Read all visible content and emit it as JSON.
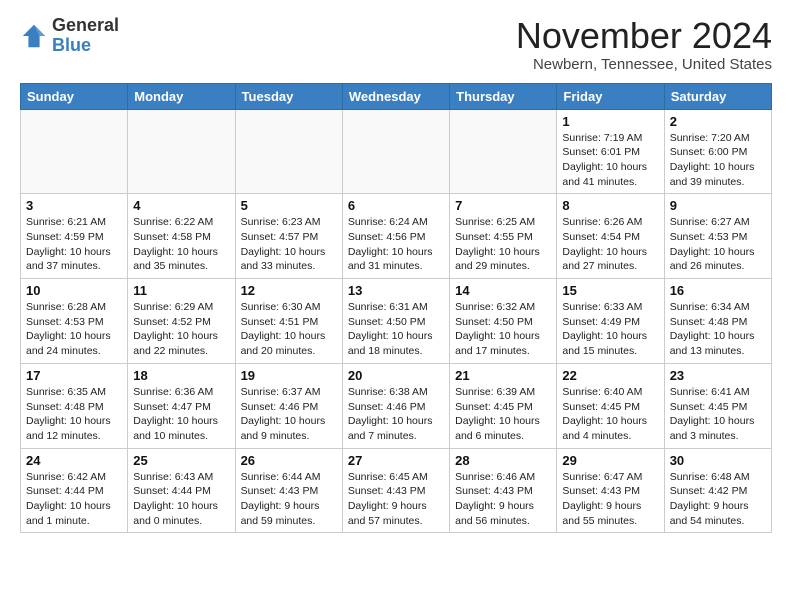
{
  "logo": {
    "general": "General",
    "blue": "Blue"
  },
  "header": {
    "month": "November 2024",
    "location": "Newbern, Tennessee, United States"
  },
  "weekdays": [
    "Sunday",
    "Monday",
    "Tuesday",
    "Wednesday",
    "Thursday",
    "Friday",
    "Saturday"
  ],
  "weeks": [
    [
      {
        "day": "",
        "info": ""
      },
      {
        "day": "",
        "info": ""
      },
      {
        "day": "",
        "info": ""
      },
      {
        "day": "",
        "info": ""
      },
      {
        "day": "",
        "info": ""
      },
      {
        "day": "1",
        "info": "Sunrise: 7:19 AM\nSunset: 6:01 PM\nDaylight: 10 hours\nand 41 minutes."
      },
      {
        "day": "2",
        "info": "Sunrise: 7:20 AM\nSunset: 6:00 PM\nDaylight: 10 hours\nand 39 minutes."
      }
    ],
    [
      {
        "day": "3",
        "info": "Sunrise: 6:21 AM\nSunset: 4:59 PM\nDaylight: 10 hours\nand 37 minutes."
      },
      {
        "day": "4",
        "info": "Sunrise: 6:22 AM\nSunset: 4:58 PM\nDaylight: 10 hours\nand 35 minutes."
      },
      {
        "day": "5",
        "info": "Sunrise: 6:23 AM\nSunset: 4:57 PM\nDaylight: 10 hours\nand 33 minutes."
      },
      {
        "day": "6",
        "info": "Sunrise: 6:24 AM\nSunset: 4:56 PM\nDaylight: 10 hours\nand 31 minutes."
      },
      {
        "day": "7",
        "info": "Sunrise: 6:25 AM\nSunset: 4:55 PM\nDaylight: 10 hours\nand 29 minutes."
      },
      {
        "day": "8",
        "info": "Sunrise: 6:26 AM\nSunset: 4:54 PM\nDaylight: 10 hours\nand 27 minutes."
      },
      {
        "day": "9",
        "info": "Sunrise: 6:27 AM\nSunset: 4:53 PM\nDaylight: 10 hours\nand 26 minutes."
      }
    ],
    [
      {
        "day": "10",
        "info": "Sunrise: 6:28 AM\nSunset: 4:53 PM\nDaylight: 10 hours\nand 24 minutes."
      },
      {
        "day": "11",
        "info": "Sunrise: 6:29 AM\nSunset: 4:52 PM\nDaylight: 10 hours\nand 22 minutes."
      },
      {
        "day": "12",
        "info": "Sunrise: 6:30 AM\nSunset: 4:51 PM\nDaylight: 10 hours\nand 20 minutes."
      },
      {
        "day": "13",
        "info": "Sunrise: 6:31 AM\nSunset: 4:50 PM\nDaylight: 10 hours\nand 18 minutes."
      },
      {
        "day": "14",
        "info": "Sunrise: 6:32 AM\nSunset: 4:50 PM\nDaylight: 10 hours\nand 17 minutes."
      },
      {
        "day": "15",
        "info": "Sunrise: 6:33 AM\nSunset: 4:49 PM\nDaylight: 10 hours\nand 15 minutes."
      },
      {
        "day": "16",
        "info": "Sunrise: 6:34 AM\nSunset: 4:48 PM\nDaylight: 10 hours\nand 13 minutes."
      }
    ],
    [
      {
        "day": "17",
        "info": "Sunrise: 6:35 AM\nSunset: 4:48 PM\nDaylight: 10 hours\nand 12 minutes."
      },
      {
        "day": "18",
        "info": "Sunrise: 6:36 AM\nSunset: 4:47 PM\nDaylight: 10 hours\nand 10 minutes."
      },
      {
        "day": "19",
        "info": "Sunrise: 6:37 AM\nSunset: 4:46 PM\nDaylight: 10 hours\nand 9 minutes."
      },
      {
        "day": "20",
        "info": "Sunrise: 6:38 AM\nSunset: 4:46 PM\nDaylight: 10 hours\nand 7 minutes."
      },
      {
        "day": "21",
        "info": "Sunrise: 6:39 AM\nSunset: 4:45 PM\nDaylight: 10 hours\nand 6 minutes."
      },
      {
        "day": "22",
        "info": "Sunrise: 6:40 AM\nSunset: 4:45 PM\nDaylight: 10 hours\nand 4 minutes."
      },
      {
        "day": "23",
        "info": "Sunrise: 6:41 AM\nSunset: 4:45 PM\nDaylight: 10 hours\nand 3 minutes."
      }
    ],
    [
      {
        "day": "24",
        "info": "Sunrise: 6:42 AM\nSunset: 4:44 PM\nDaylight: 10 hours\nand 1 minute."
      },
      {
        "day": "25",
        "info": "Sunrise: 6:43 AM\nSunset: 4:44 PM\nDaylight: 10 hours\nand 0 minutes."
      },
      {
        "day": "26",
        "info": "Sunrise: 6:44 AM\nSunset: 4:43 PM\nDaylight: 9 hours\nand 59 minutes."
      },
      {
        "day": "27",
        "info": "Sunrise: 6:45 AM\nSunset: 4:43 PM\nDaylight: 9 hours\nand 57 minutes."
      },
      {
        "day": "28",
        "info": "Sunrise: 6:46 AM\nSunset: 4:43 PM\nDaylight: 9 hours\nand 56 minutes."
      },
      {
        "day": "29",
        "info": "Sunrise: 6:47 AM\nSunset: 4:43 PM\nDaylight: 9 hours\nand 55 minutes."
      },
      {
        "day": "30",
        "info": "Sunrise: 6:48 AM\nSunset: 4:42 PM\nDaylight: 9 hours\nand 54 minutes."
      }
    ]
  ]
}
